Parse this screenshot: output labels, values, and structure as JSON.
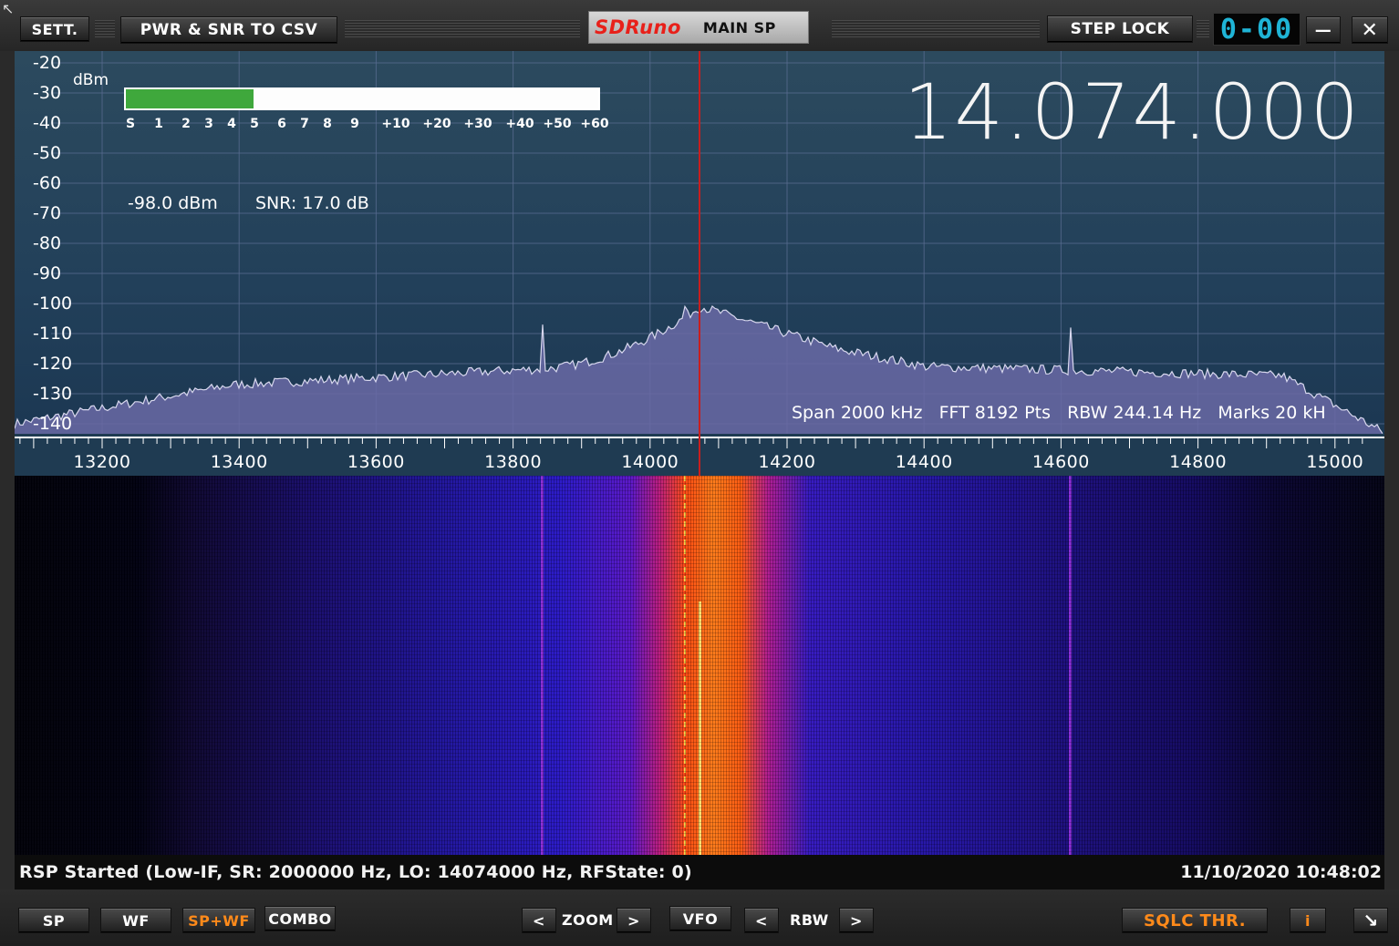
{
  "toolbar": {
    "settings_label": "SETT.",
    "export_label": "PWR & SNR TO CSV",
    "brand": "SDRuno",
    "window_title": "MAIN SP",
    "step_lock_label": "STEP LOCK",
    "lcd_display": "0-00",
    "minimize_label": "—",
    "close_label": "✕"
  },
  "spectrum": {
    "unit_label": "dBm",
    "y_ticks": [
      "-20",
      "-30",
      "-40",
      "-50",
      "-60",
      "-70",
      "-80",
      "-90",
      "-100",
      "-110",
      "-120",
      "-130",
      "-140"
    ],
    "x_ticks": [
      "13200",
      "13400",
      "13600",
      "13800",
      "14000",
      "14200",
      "14400",
      "14600",
      "14800",
      "15000"
    ],
    "frequency_display": "14.074.000",
    "power_readout": "-98.0 dBm",
    "snr_readout": "SNR: 17.0 dB",
    "fft_info": "Span 2000 kHz   FFT 8192 Pts   RBW 244.14 Hz   Marks 20 kH",
    "s_meter": {
      "labels": [
        "S",
        "1",
        "2",
        "3",
        "4",
        "5",
        "6",
        "7",
        "8",
        "9",
        "+10",
        "+20",
        "+30",
        "+40",
        "+50",
        "+60"
      ],
      "level_fraction": 0.27,
      "fill_color": "#3fa83c"
    }
  },
  "status": {
    "message": "RSP Started (Low-IF, SR: 2000000 Hz, LO: 14074000 Hz, RFState: 0)",
    "timestamp": "11/10/2020 10:48:02"
  },
  "bottom": {
    "sp_label": "SP",
    "wf_label": "WF",
    "spwf_label": "SP+WF",
    "combo_label": "COMBO",
    "zoom_label": "ZOOM",
    "vfo_label": "VFO",
    "rbw_label": "RBW",
    "prev_symbol": "<",
    "next_symbol": ">",
    "sqlc_label": "SQLC THR.",
    "info_label": "i",
    "resize_symbol": "↘"
  },
  "colors": {
    "accent_orange": "#ff8a1a",
    "brand_red": "#e8201a",
    "lcd_cyan": "#1fb4d6",
    "vfo_marker": "#c81e1e"
  }
}
